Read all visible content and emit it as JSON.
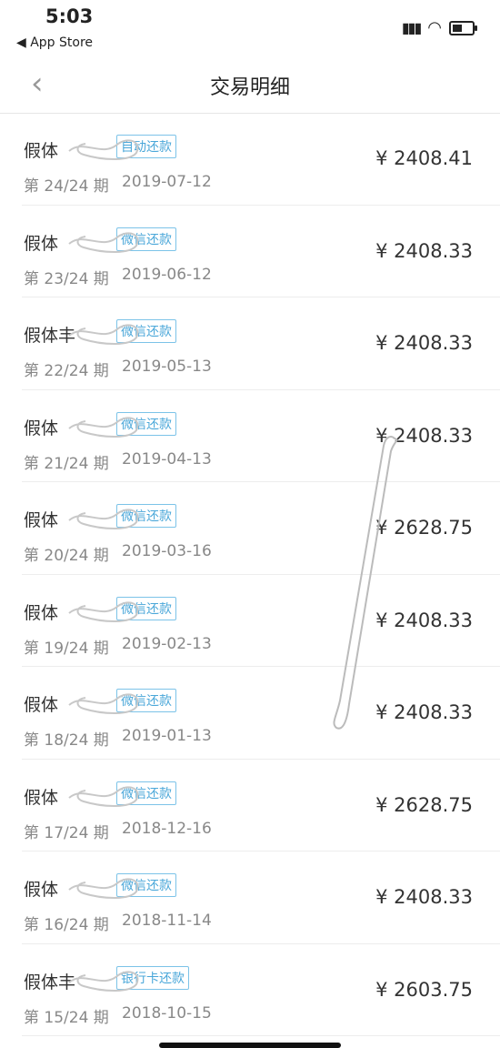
{
  "status": {
    "time": "5:03",
    "back_app": "◀ App Store",
    "signal_icon": "signal-icon",
    "wifi_icon": "wifi-icon",
    "battery_icon": "battery-icon"
  },
  "nav": {
    "back_icon": "chevron-left-icon",
    "title": "交易明细"
  },
  "transactions": [
    {
      "name": "假体",
      "badge": "自动还款",
      "period": "第 24/24 期",
      "date": "2019-07-12",
      "amount": "¥ 2408.41"
    },
    {
      "name": "假体",
      "badge": "微信还款",
      "period": "第 23/24 期",
      "date": "2019-06-12",
      "amount": "¥ 2408.33"
    },
    {
      "name": "假体丰",
      "badge": "微信还款",
      "period": "第 22/24 期",
      "date": "2019-05-13",
      "amount": "¥ 2408.33"
    },
    {
      "name": "假体",
      "badge": "微信还款",
      "period": "第 21/24 期",
      "date": "2019-04-13",
      "amount": "¥ 2408.33"
    },
    {
      "name": "假体",
      "badge": "微信还款",
      "period": "第 20/24 期",
      "date": "2019-03-16",
      "amount": "¥ 2628.75"
    },
    {
      "name": "假体",
      "badge": "微信还款",
      "period": "第 19/24 期",
      "date": "2019-02-13",
      "amount": "¥ 2408.33"
    },
    {
      "name": "假体",
      "badge": "微信还款",
      "period": "第 18/24 期",
      "date": "2019-01-13",
      "amount": "¥ 2408.33"
    },
    {
      "name": "假体",
      "badge": "微信还款",
      "period": "第 17/24 期",
      "date": "2018-12-16",
      "amount": "¥ 2628.75"
    },
    {
      "name": "假体",
      "badge": "微信还款",
      "period": "第 16/24 期",
      "date": "2018-11-14",
      "amount": "¥ 2408.33"
    },
    {
      "name": "假体丰",
      "badge": "银行卡还款",
      "period": "第 15/24 期",
      "date": "2018-10-15",
      "amount": "¥ 2603.75"
    }
  ]
}
